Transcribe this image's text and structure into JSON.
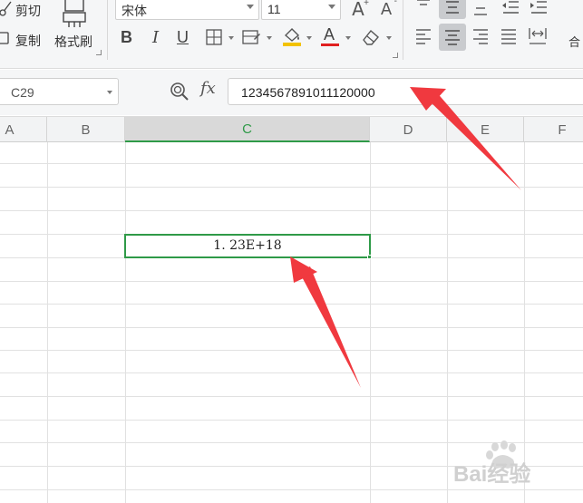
{
  "ribbon": {
    "cut_label": "剪切",
    "copy_label": "复制",
    "format_painter_label": "格式刷",
    "font_name": "宋体",
    "font_size": "11",
    "bold": "B",
    "italic": "I",
    "underline": "U",
    "increase_font": "A",
    "decrease_font": "A",
    "font_color_letter": "A",
    "merge_partial": "合",
    "colors": {
      "font_color_bar": "#e02020",
      "fill_bar": "#f2c200"
    }
  },
  "formula_bar": {
    "name_box": "C29",
    "fx_label": "fx",
    "formula_value": "1234567891011120000"
  },
  "grid": {
    "columns": [
      "A",
      "B",
      "C",
      "D",
      "E",
      "F"
    ],
    "active_column": "C",
    "active_cell_display": "1. 23E+18"
  },
  "annotations": {
    "arrow_color": "#f0393f"
  },
  "watermark": {
    "text": "Bai经验"
  }
}
